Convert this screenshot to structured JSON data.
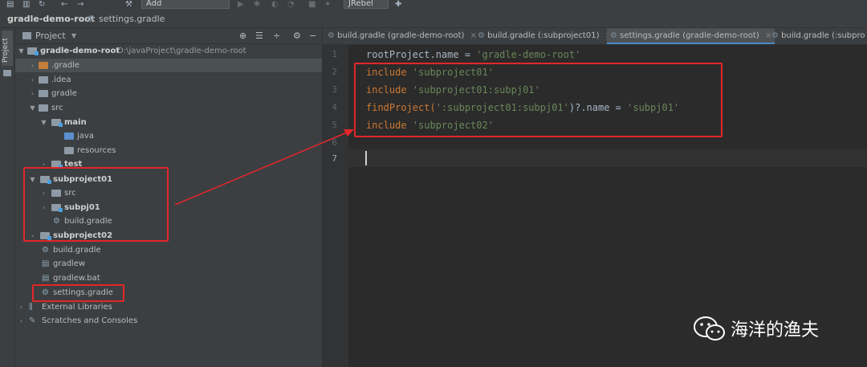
{
  "toolbar": {
    "config_label": "Add Configuration...",
    "jrebel_label": "JRebel"
  },
  "breadcrumb": {
    "root": "gradle-demo-root",
    "file": "settings.gradle"
  },
  "side_strip": {
    "project_tab": "Project"
  },
  "project_panel": {
    "title": "Project",
    "tree": {
      "root_name": "gradle-demo-root",
      "root_path": "D:\\javaProject\\gradle-demo-root",
      "gradle_hidden": ".gradle",
      "idea": ".idea",
      "gradle": "gradle",
      "src": "src",
      "main": "main",
      "java": "java",
      "resources": "resources",
      "test": "test",
      "subproject01": "subproject01",
      "sub_src": "src",
      "subpj01": "subpj01",
      "sub_build": "build.gradle",
      "subproject02": "subproject02",
      "build_gradle": "build.gradle",
      "gradlew": "gradlew",
      "gradlew_bat": "gradlew.bat",
      "settings_gradle": "settings.gradle",
      "external_libraries": "External Libraries",
      "scratches": "Scratches and Consoles"
    }
  },
  "editor_tabs": [
    {
      "label": "build.gradle (gradle-demo-root)"
    },
    {
      "label": "build.gradle (:subproject01)"
    },
    {
      "label": "settings.gradle (gradle-demo-root)"
    },
    {
      "label": "build.gradle (:subpro"
    }
  ],
  "editor": {
    "line_numbers": [
      "1",
      "2",
      "3",
      "4",
      "5",
      "6",
      "7"
    ],
    "line1": {
      "prop": "rootProject.name = ",
      "str": "'gradle-demo-root'"
    },
    "line2": {
      "kw": "include ",
      "str": "'subproject01'"
    },
    "line3": {
      "kw": "include ",
      "str": "'subproject01:subpj01'"
    },
    "line4": {
      "fn": "findProject(",
      "str": "':subproject01:subpj01'",
      "mid": ")?.name = ",
      "str2": "'subpj01'"
    },
    "line5": {
      "kw": "include ",
      "str": "'subproject02'"
    }
  },
  "watermark": {
    "text": "海洋的渔夫"
  },
  "colors": {
    "highlight_red": "#e3262a",
    "keyword": "#cc7832",
    "string": "#6a8759",
    "code_text": "#a9b7c6"
  }
}
